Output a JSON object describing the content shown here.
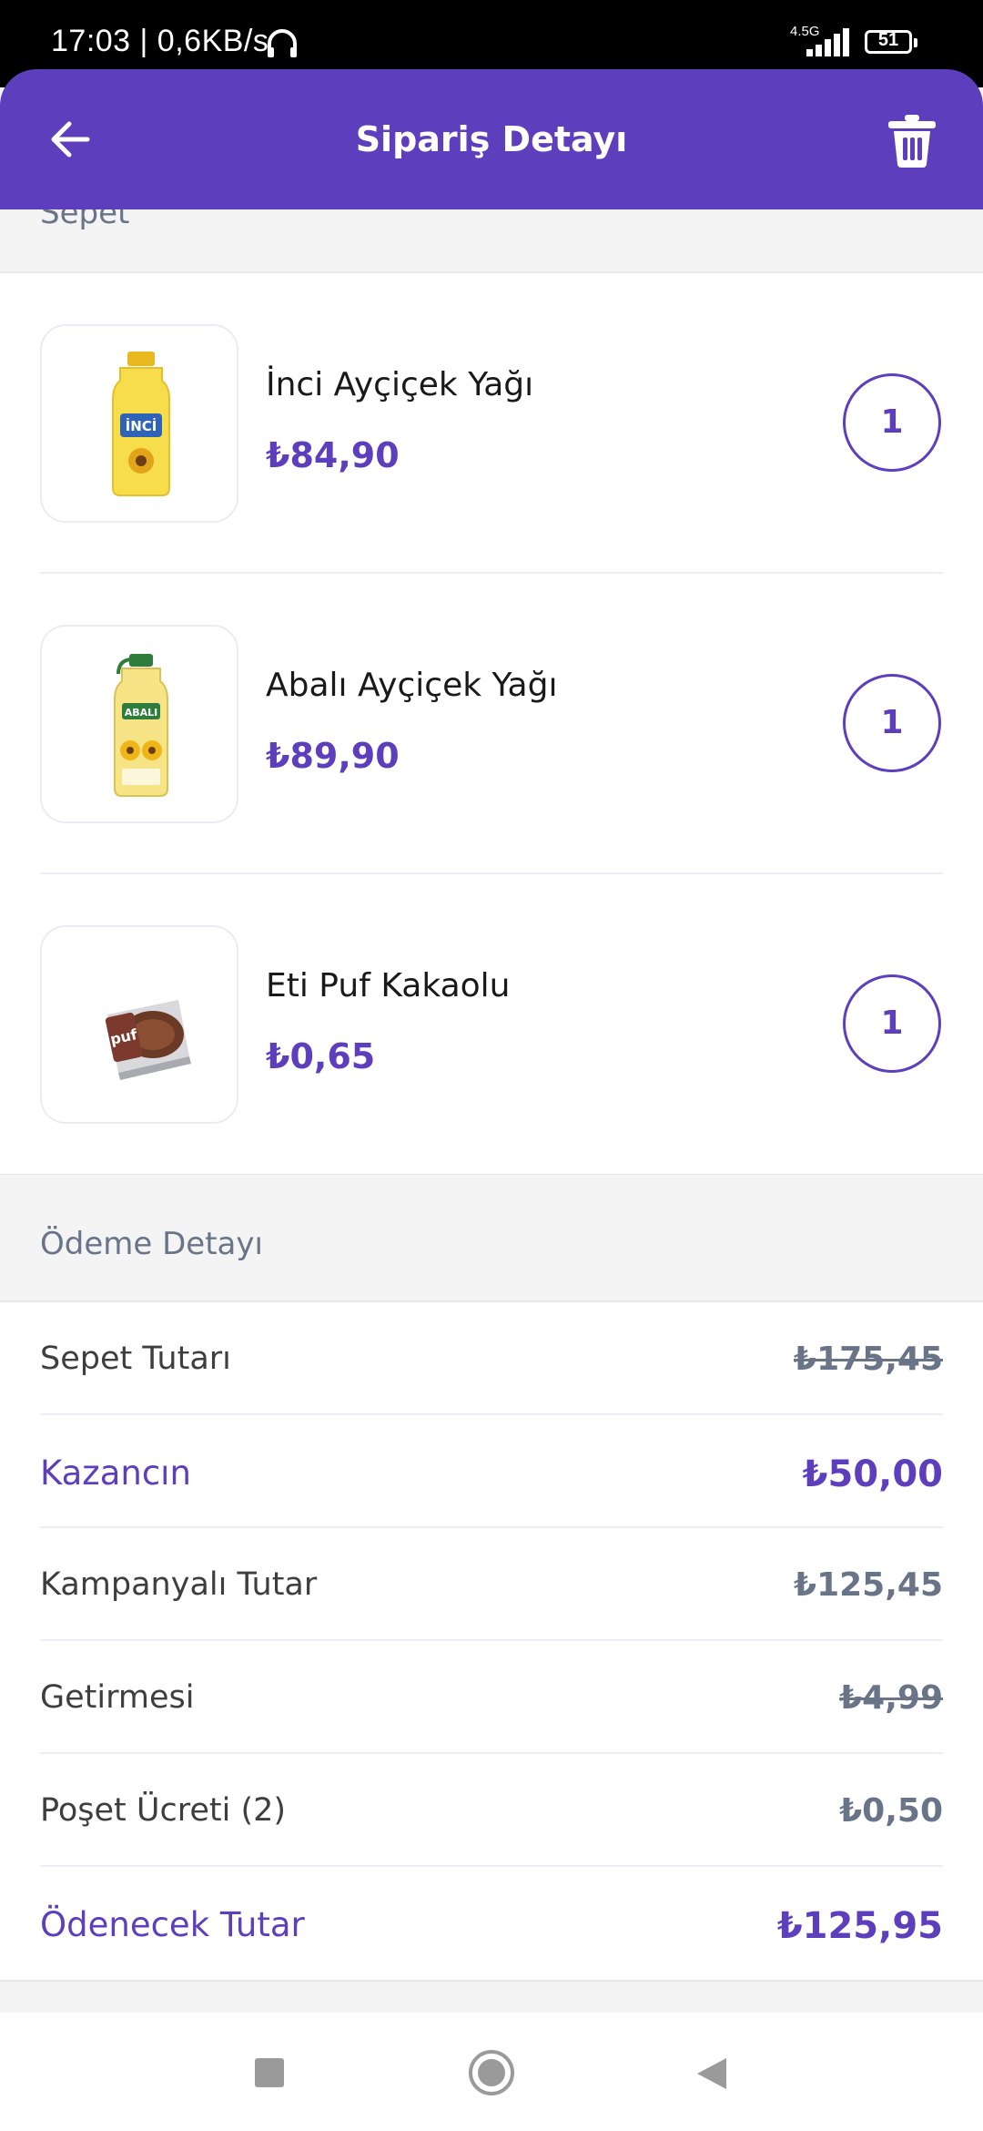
{
  "status_bar": {
    "time": "17:03 | 0,6KB/s",
    "network": "4.5G",
    "battery": "51"
  },
  "header": {
    "title": "Sipariş Detayı",
    "back_icon": "arrow-left-icon",
    "delete_icon": "trash-icon"
  },
  "basket": {
    "section_title": "Sepet",
    "items": [
      {
        "name": "İnci Ayçiçek Yağı",
        "price": "₺84,90",
        "quantity": "1"
      },
      {
        "name": "Abalı Ayçiçek Yağı",
        "price": "₺89,90",
        "quantity": "1"
      },
      {
        "name": "Eti Puf Kakaolu",
        "price": "₺0,65",
        "quantity": "1"
      }
    ]
  },
  "payment": {
    "section_title": "Ödeme Detayı",
    "rows": [
      {
        "label": "Sepet Tutarı",
        "value": "₺175,45"
      },
      {
        "label": "Kazancın",
        "value": "₺50,00"
      },
      {
        "label": "Kampanyalı Tutar",
        "value": "₺125,45"
      },
      {
        "label": "Getirmesi",
        "value": "₺4,99"
      },
      {
        "label": "Poşet Ücreti (2)",
        "value": "₺0,50"
      },
      {
        "label": "Ödenecek Tutar",
        "value": "₺125,95"
      }
    ]
  },
  "colors": {
    "brand": "#5d3ebc",
    "muted": "#697488"
  },
  "nav_bar": {
    "icons": [
      "recents-square-icon",
      "home-circle-icon",
      "back-triangle-icon"
    ]
  }
}
